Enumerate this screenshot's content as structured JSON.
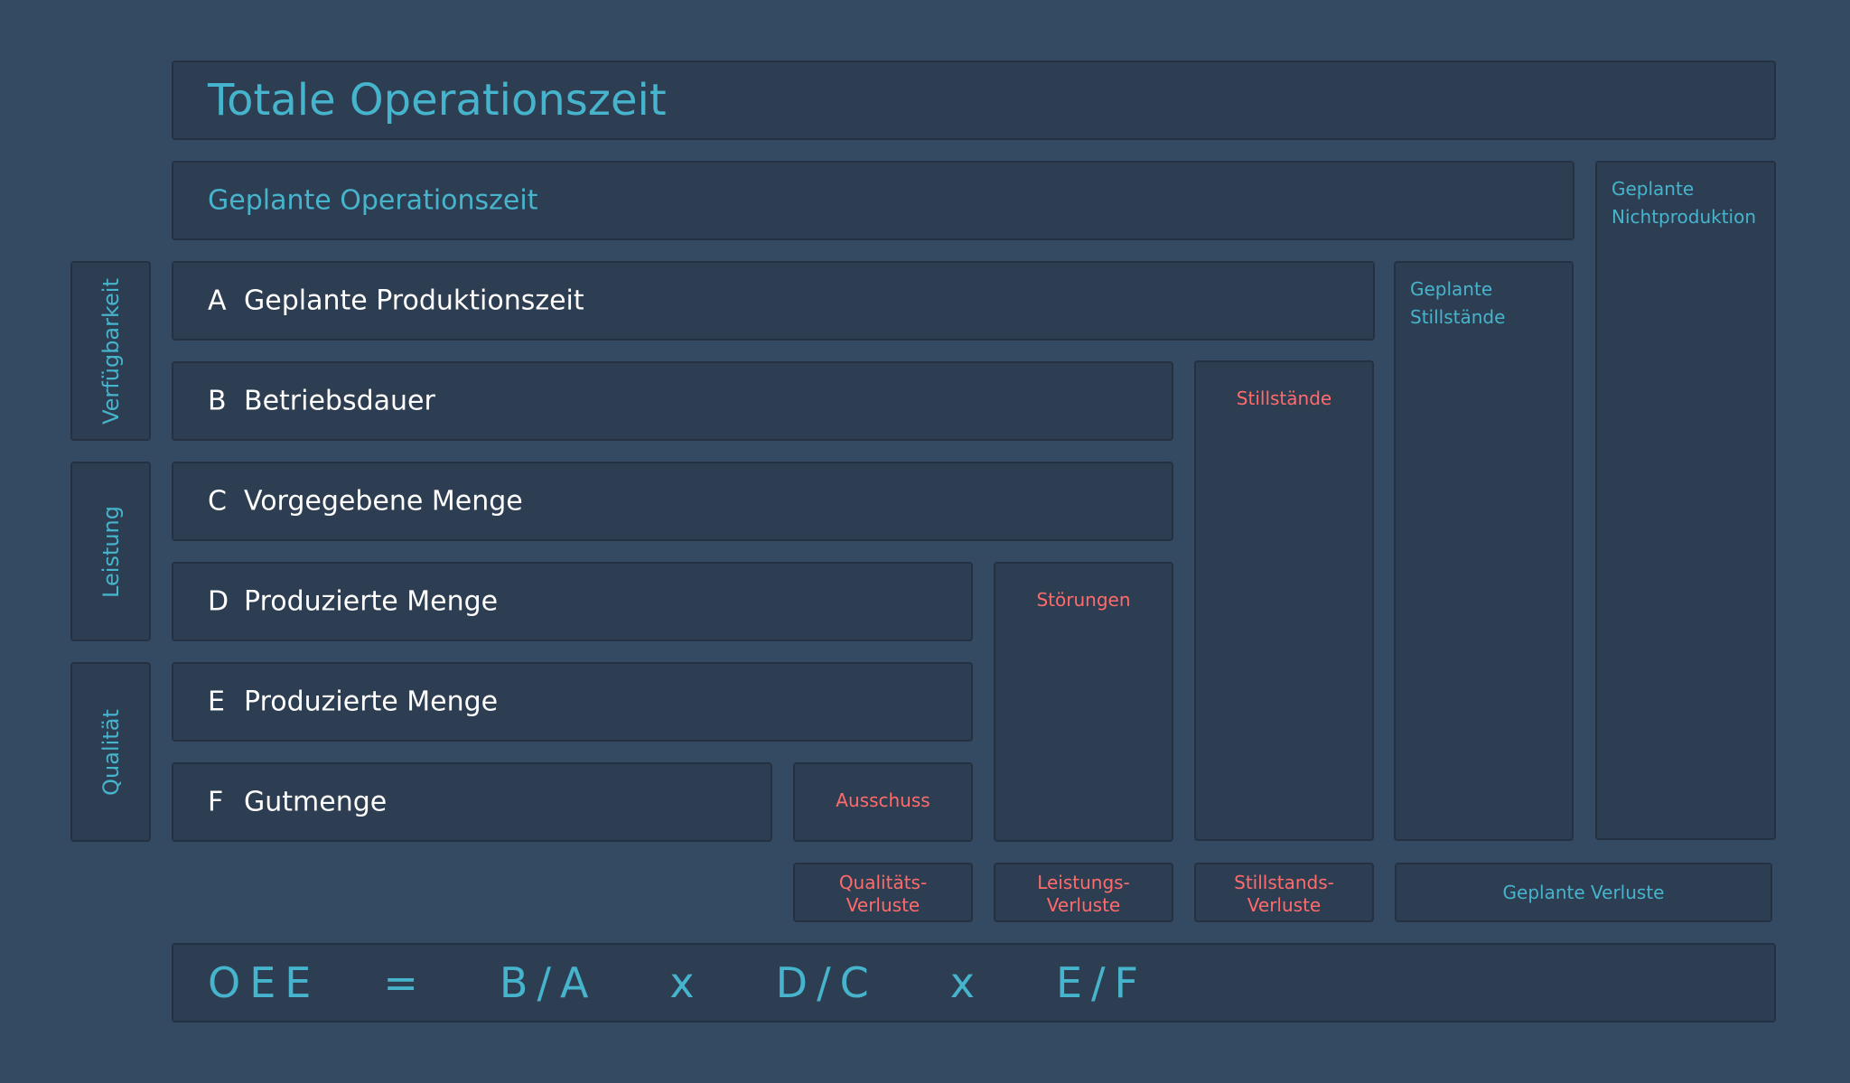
{
  "title": "Totale Operationszeit",
  "planned_operation": "Geplante Operationszeit",
  "planned_non_production": [
    "Geplante",
    "Nichtproduktion"
  ],
  "planned_downtime": [
    "Geplante",
    "Stillstände"
  ],
  "rows": [
    {
      "letter": "A",
      "label": "Geplante Produktionszeit"
    },
    {
      "letter": "B",
      "label": "Betriebsdauer"
    },
    {
      "letter": "C",
      "label": "Vorgegebene Menge"
    },
    {
      "letter": "D",
      "label": "Produzierte Menge"
    },
    {
      "letter": "E",
      "label": "Produzierte Menge"
    },
    {
      "letter": "F",
      "label": "Gutmenge"
    }
  ],
  "losses": {
    "downtime": "Stillstände",
    "disruptions": "Störungen",
    "scrap": "Ausschuss"
  },
  "loss_categories": {
    "quality": [
      "Qualitäts-",
      "Verluste"
    ],
    "performance": [
      "Leistungs-",
      "Verluste"
    ],
    "downtime": [
      "Stillstands-",
      "Verluste"
    ],
    "planned": "Geplante Verluste"
  },
  "side_labels": {
    "availability": "Verfügbarkeit",
    "performance": "Leistung",
    "quality": "Qualität"
  },
  "formula": {
    "oee": "OEE",
    "eq": "=",
    "term1": "B/A",
    "times1": "x",
    "term2": "D/C",
    "times2": "x",
    "term3": "E/F"
  },
  "colors": {
    "background": "#344a62",
    "box": "#2e3e52",
    "accent": "#46b4cc",
    "loss": "#ff6b6b",
    "text": "#ffffff"
  }
}
